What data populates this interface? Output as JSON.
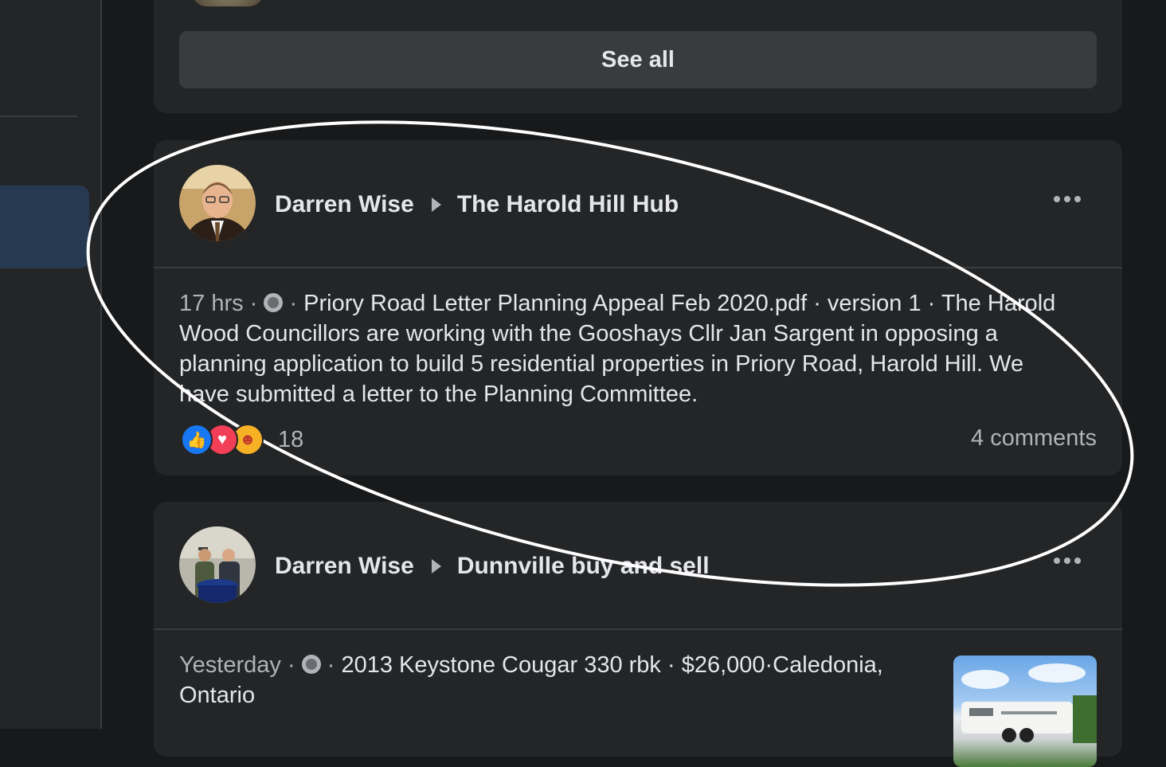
{
  "see_all": {
    "label": "See all"
  },
  "posts": [
    {
      "author": "Darren Wise",
      "group": "The Harold Hill Hub",
      "time": "17 hrs",
      "privacy_icon": "group-icon",
      "text": "Priory Road Letter Planning Appeal Feb 2020.pdf · version 1 · The Harold Wood Councillors are working with the Gooshays Cllr Jan Sargent in opposing a planning application to build 5 residential properties in Priory Road, Harold Hill. We have submitted a letter to the Planning Committee.",
      "reactions": [
        "like",
        "love",
        "care"
      ],
      "reaction_count": "18",
      "comments": "4 comments"
    },
    {
      "author": "Darren Wise",
      "group": "Dunnville buy and sell",
      "time": "Yesterday",
      "privacy_icon": "globe-icon",
      "text": "2013 Keystone Cougar 330 rbk · $26,000·Caledonia, Ontario"
    }
  ],
  "colors": {
    "background": "#18191a",
    "card": "#242526",
    "button": "#3a3b3c",
    "text_primary": "#e4e6eb",
    "text_secondary": "#b0b3b8",
    "like": "#1877f2",
    "love": "#f33e58",
    "care": "#f7b125",
    "annotation": "#ffffff"
  }
}
